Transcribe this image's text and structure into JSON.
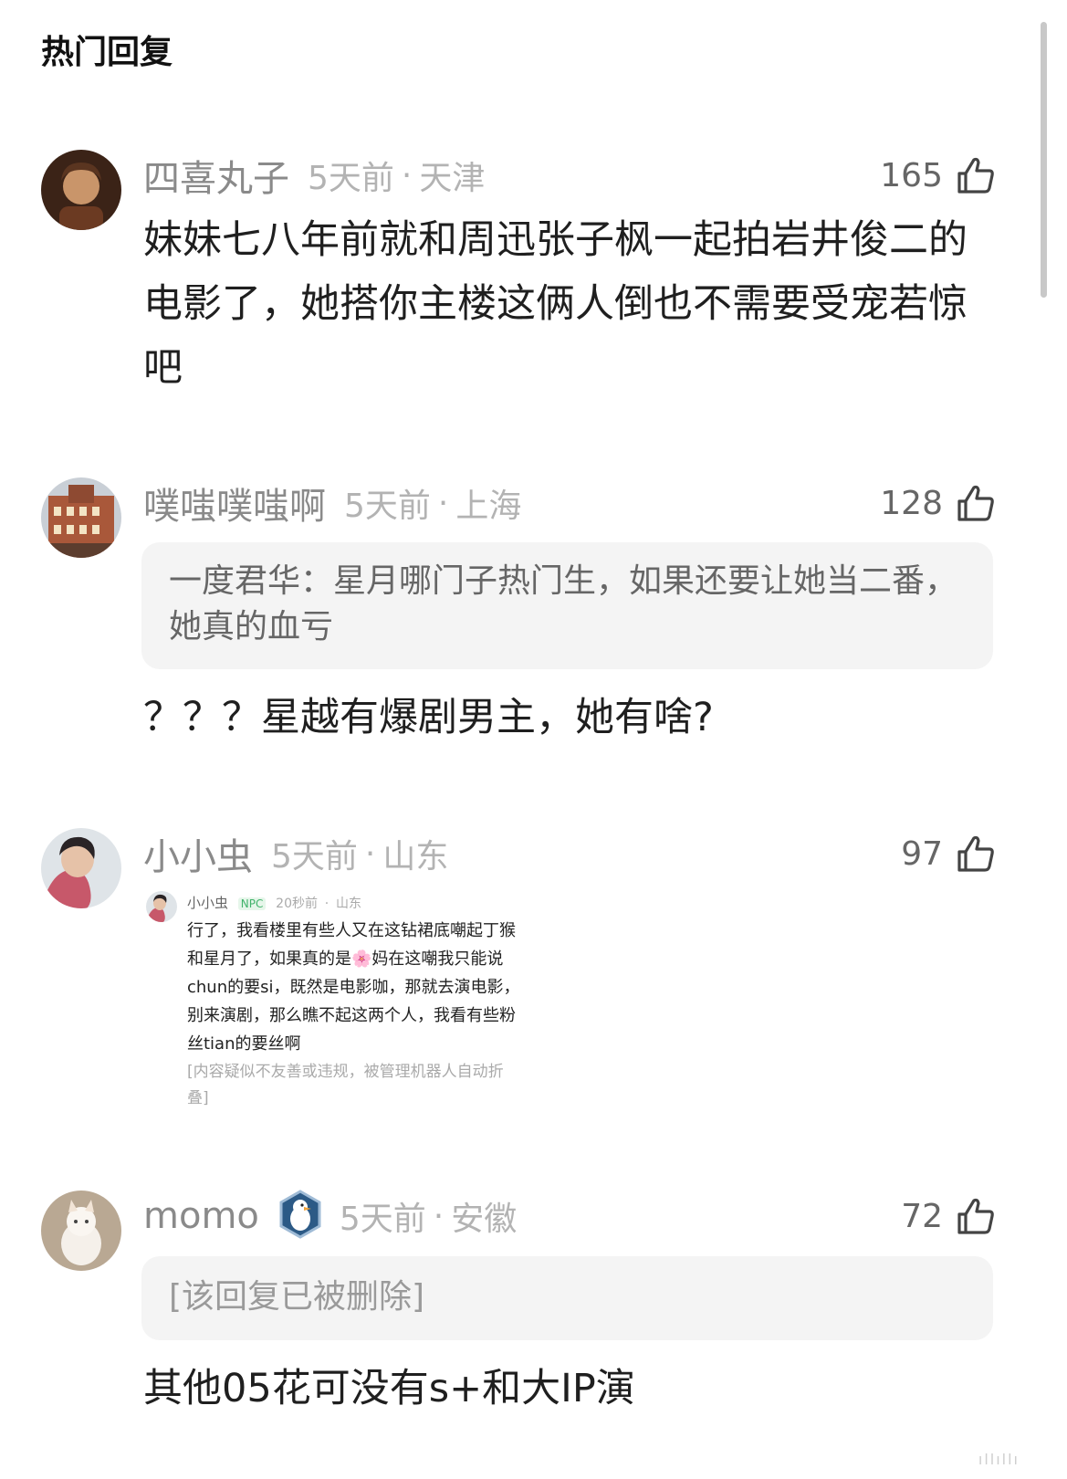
{
  "header": {
    "title": "热门回复"
  },
  "comments": [
    {
      "username": "四喜丸子",
      "time": "5天前",
      "location": "天津",
      "likes": "165",
      "body": "妹妹七八年前就和周迅张子枫一起拍岩井俊二的电影了，她搭你主楼这俩人倒也不需要受宠若惊吧"
    },
    {
      "username": "噗嗤噗嗤啊",
      "time": "5天前",
      "location": "上海",
      "likes": "128",
      "quote": "一度君华：星月哪门子热门生，如果还要让她当二番，她真的血亏",
      "body": "？？？星越有爆剧男主，她有啥?"
    },
    {
      "username": "小小虫",
      "time": "5天前",
      "location": "山东",
      "likes": "97",
      "embedded": {
        "username": "小小虫",
        "tag": "NPC",
        "time": "20秒前",
        "location": "山东",
        "body": "行了，我看楼里有些人又在这钻裙底嘲起丁猴和星月了，如果真的是🌸妈在这嘲我只能说chun的要si，既然是电影咖，那就去演电影，别来演剧，那么瞧不起这两个人，我看有些粉丝tian的要丝啊",
        "note": "[内容疑似不友善或违规，被管理机器人自动折叠]"
      }
    },
    {
      "username": "momo",
      "time": "5天前",
      "location": "安徽",
      "likes": "72",
      "badge_icon": "penguin-badge-icon",
      "quote": "[该回复已被删除]",
      "body": "其他05花可没有s+和大IP演"
    }
  ],
  "meta_separator": "·",
  "icons": {
    "like": "thumbs-up-icon"
  },
  "colors": {
    "username": "#8a8a8a",
    "meta": "#b3b3b3",
    "quote_bg": "#f4f4f4",
    "npc_tag": "#41b36b"
  }
}
